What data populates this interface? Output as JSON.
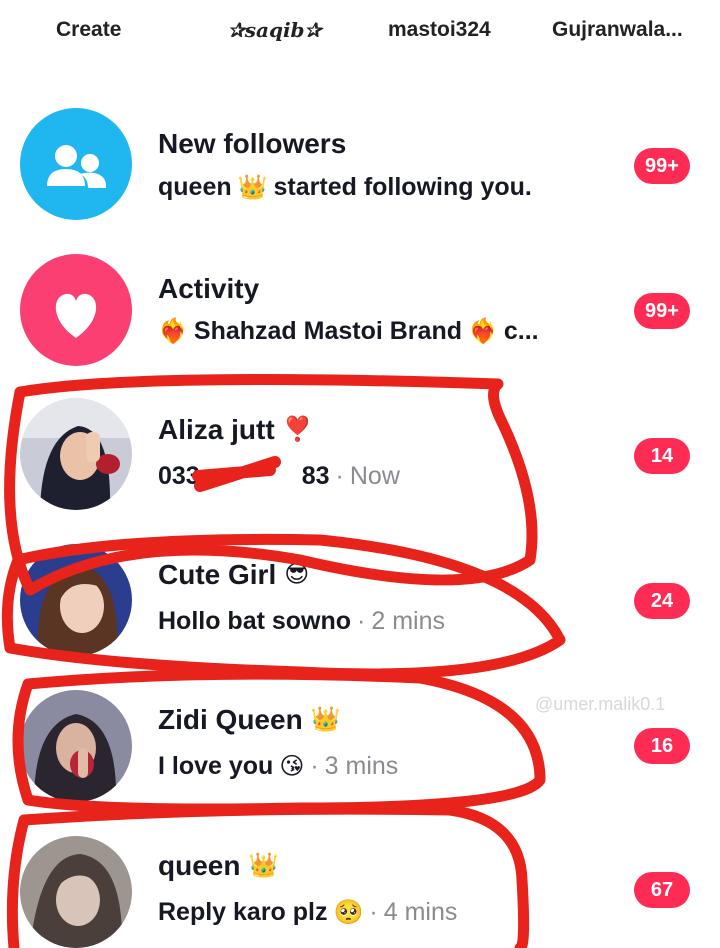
{
  "header": {
    "tabs": [
      {
        "label": "Create"
      },
      {
        "label": "✰saqib✰"
      },
      {
        "label": "mastoi324"
      },
      {
        "label": "Gujranwala..."
      }
    ]
  },
  "system_rows": [
    {
      "title": "New followers",
      "subtitle_start": "queen",
      "subtitle_emoji": "👑",
      "subtitle_end": "started following you.",
      "badge": "99+",
      "icon": "followers-icon",
      "color": "#20b7f0"
    },
    {
      "title": "Activity",
      "subtitle": "Shahzad Mastoi Brand",
      "subtitle_end": "c...",
      "badge": "99+",
      "icon": "heart-icon",
      "color": "#fb3f73"
    }
  ],
  "conversations": [
    {
      "name": "Aliza jutt",
      "name_emoji": "❣️",
      "message": "033",
      "message_end": "83",
      "time": "Now",
      "badge": "14"
    },
    {
      "name": "Cute Girl",
      "name_emoji": "😎",
      "message": "Hollo bat sowno",
      "time": "2 mins",
      "badge": "24"
    },
    {
      "name": "Zidi Queen",
      "name_emoji": "👑",
      "message": "I love you",
      "message_emoji": "😘",
      "time": "3 mins",
      "badge": "16"
    },
    {
      "name": "queen",
      "name_emoji": "👑",
      "message": "Reply karo plz",
      "message_emoji": "🥺",
      "time": "4 mins",
      "badge": "67"
    }
  ],
  "time_separator": "·",
  "watermark": "@umer.malik0.1",
  "colors": {
    "badge": "#fe2c55",
    "annotation": "#e8231b",
    "muted_text": "#8a8b91"
  }
}
